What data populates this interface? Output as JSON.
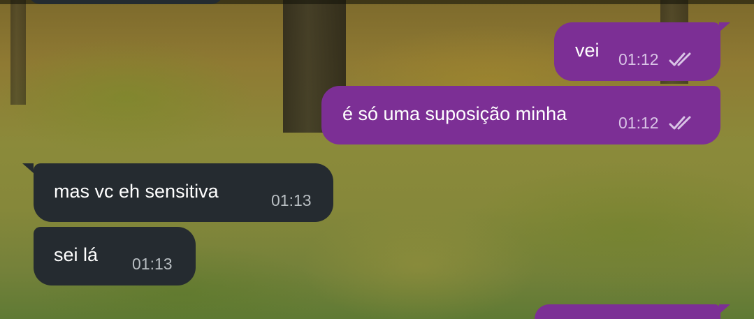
{
  "chat": {
    "messages": [
      {
        "direction": "out",
        "text": "vei",
        "time": "01:12",
        "status_icon": "double-check-icon"
      },
      {
        "direction": "out",
        "text": "é só uma suposição minha",
        "time": "01:12",
        "status_icon": "double-check-icon"
      },
      {
        "direction": "in",
        "text": "mas vc eh sensitiva",
        "time": "01:13"
      },
      {
        "direction": "in",
        "text": "sei lá",
        "time": "01:13"
      }
    ]
  },
  "colors": {
    "outgoing_bubble": "#7c2f95",
    "incoming_bubble": "#252b30",
    "outgoing_meta": "#d9c4e6",
    "incoming_meta": "#b8bec2",
    "text": "#ffffff"
  }
}
